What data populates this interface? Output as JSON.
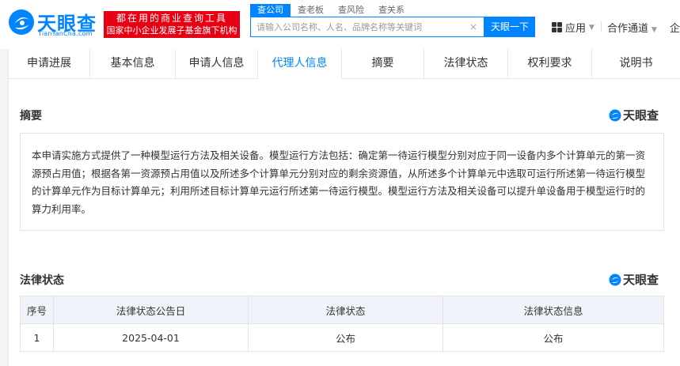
{
  "header": {
    "logo": {
      "name": "天眼查",
      "domain": "TianYanCha.com"
    },
    "promo": {
      "line1": "都在用的商业查询工具",
      "line2": "国家中小企业发展子基金旗下机构"
    },
    "search_tabs": [
      "查公司",
      "查老板",
      "查风险",
      "查关系"
    ],
    "search": {
      "placeholder": "请输入公司名称、人名、品牌名称等关键词",
      "clear_icon": "×",
      "button_label": "天眼一下"
    },
    "apps_label": "应用",
    "cooperation_label": "合作通道",
    "enterprise_label": "企"
  },
  "tabs": [
    "申请进展",
    "基本信息",
    "申请人信息",
    "代理人信息",
    "摘要",
    "法律状态",
    "权利要求",
    "说明书"
  ],
  "active_tab_index": 3,
  "abstract": {
    "title": "摘要",
    "brand": "天眼查",
    "text": "本申请实施方式提供了一种模型运行方法及相关设备。模型运行方法包括：确定第一待运行模型分别对应于同一设备内多个计算单元的第一资源预占用值；根据各第一资源预占用值以及所述多个计算单元分别对应的剩余资源值，从所述多个计算单元中选取可运行所述第一待运行模型的计算单元作为目标计算单元；利用所述目标计算单元运行所述第一待运行模型。模型运行方法及相关设备可以提升单设备用于模型运行时的算力利用率。"
  },
  "legal_status": {
    "title": "法律状态",
    "brand": "天眼查",
    "columns": [
      "序号",
      "法律状态公告日",
      "法律状态",
      "法律状态信息"
    ],
    "rows": [
      [
        "1",
        "2025-04-01",
        "公布",
        "公布"
      ]
    ]
  },
  "colors": {
    "brand_blue": "#0084ff",
    "promo_red": "#e60012",
    "header_row": "#f0f4fa"
  }
}
